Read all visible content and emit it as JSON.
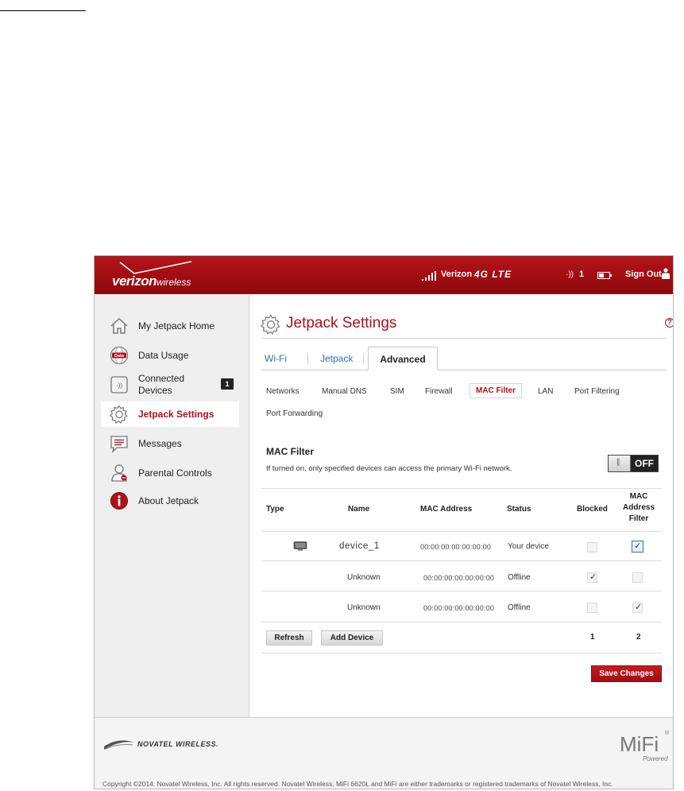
{
  "header": {
    "brand_bold": "verizon",
    "brand_light": "wireless",
    "carrier": "Verizon",
    "network": "4G LTE",
    "wifi_clients": "1",
    "battery_level": 0.45,
    "sign_out": "Sign Out"
  },
  "sidebar": {
    "items": [
      {
        "label": "My Jetpack Home",
        "icon": "home-icon"
      },
      {
        "label": "Data Usage",
        "icon": "data-globe-icon"
      },
      {
        "label": "Connected Devices",
        "icon": "connected-devices-icon",
        "badge": "1"
      },
      {
        "label": "Jetpack Settings",
        "icon": "gear-icon",
        "active": true
      },
      {
        "label": "Messages",
        "icon": "message-icon"
      },
      {
        "label": "Parental Controls",
        "icon": "parental-controls-icon"
      },
      {
        "label": "About Jetpack",
        "icon": "info-icon"
      }
    ]
  },
  "main": {
    "title": "Jetpack Settings",
    "help": "?",
    "tabs": [
      "Wi-Fi",
      "Jetpack",
      "Advanced"
    ],
    "active_tab": "Advanced",
    "subtabs": [
      "Networks",
      "Manual DNS",
      "SIM",
      "Firewall",
      "MAC Filter",
      "LAN",
      "Port Filtering",
      "Port Forwarding"
    ],
    "active_subtab": "MAC Filter",
    "section": {
      "title": "MAC Filter",
      "description": "If turned on, only specified devices can access the primary Wi-Fi network.",
      "toggle_state": "OFF"
    },
    "table": {
      "headers": {
        "type": "Type",
        "name": "Name",
        "mac": "MAC Address",
        "status": "Status",
        "blocked": "Blocked",
        "filter_l1": "MAC",
        "filter_l2": "Address",
        "filter_l3": "Filter"
      },
      "rows": [
        {
          "name": "device_1",
          "mac": "00:00:00:00:00:00:00",
          "status": "Your device",
          "blocked": false,
          "filter": true,
          "type_icon": "monitor-icon"
        },
        {
          "name": "Unknown",
          "mac": "00:00:00:00:00:00:00",
          "status": "Offline",
          "blocked": true,
          "filter": false
        },
        {
          "name": "Unknown",
          "mac": "00:00:00:00:00:00:00",
          "status": "Offline",
          "blocked": false,
          "filter": true
        }
      ],
      "blocked_count": "1",
      "filter_count": "2"
    },
    "buttons": {
      "refresh": "Refresh",
      "add_device": "Add Device",
      "save": "Save Changes"
    }
  },
  "footer": {
    "company": "NOVATEL WIRELESS.",
    "product": "MiFi",
    "product_reg": "®",
    "product_sub": "Powered",
    "copyright": "Copyright ©2014. Novatel Wireless, Inc. All rights reserved. Novatel Wireless, MiFi 6620L and MiFi are either trademarks or registered trademarks of Novatel Wireless, Inc."
  },
  "colors": {
    "brand_red": "#b01018",
    "link_blue": "#2a73b8",
    "sidebar_bg": "#efefef"
  }
}
